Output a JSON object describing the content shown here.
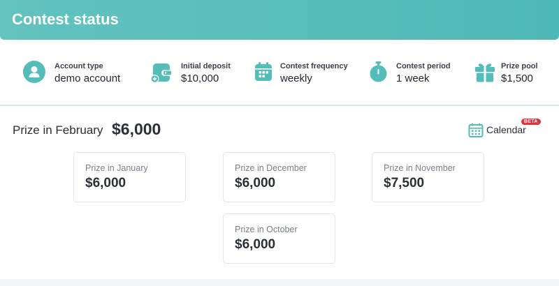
{
  "header": {
    "title": "Contest status"
  },
  "colors": {
    "accent": "#55bdb9",
    "header": "#5bbfbb",
    "beta": "#d9363e"
  },
  "info": [
    {
      "label": "Account type",
      "value": "demo account",
      "icon": "user-icon"
    },
    {
      "label": "Initial deposit",
      "value": "$10,000",
      "icon": "wallet-plus-icon"
    },
    {
      "label": "Contest frequency",
      "value": "weekly",
      "icon": "calendar-icon"
    },
    {
      "label": "Contest period",
      "value": "1 week",
      "icon": "stopwatch-icon"
    },
    {
      "label": "Prize pool",
      "value": "$1,500",
      "icon": "gift-icon"
    }
  ],
  "current_prize": {
    "label": "Prize in February",
    "value": "$6,000"
  },
  "calendar": {
    "label": "Calendar",
    "badge": "BETA",
    "icon": "calendar-grid-icon"
  },
  "past_prizes": [
    {
      "label": "Prize in January",
      "value": "$6,000"
    },
    {
      "label": "Prize in December",
      "value": "$6,000"
    },
    {
      "label": "Prize in November",
      "value": "$7,500"
    },
    {
      "label": "Prize in October",
      "value": "$6,000"
    }
  ]
}
